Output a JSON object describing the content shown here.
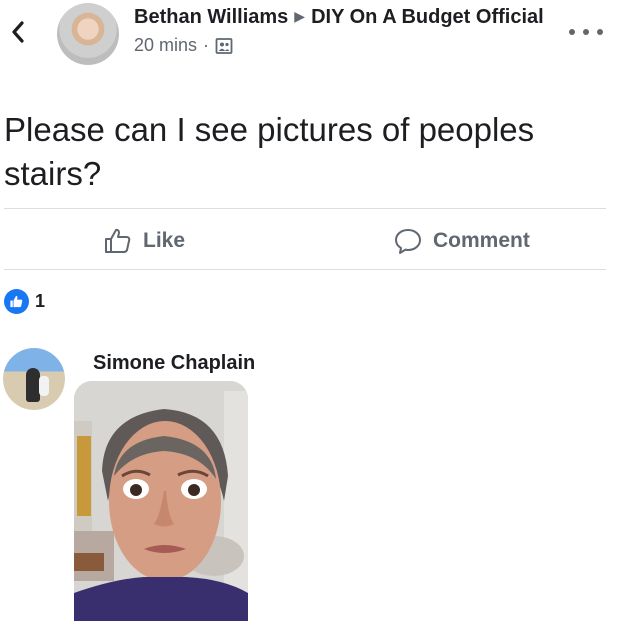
{
  "header": {
    "author": "Bethan Williams",
    "group": "DIY On A Budget Official",
    "time": "20 mins",
    "separator": "·"
  },
  "post": {
    "text": "Please can I see pictures of peoples stairs?"
  },
  "actions": {
    "like_label": "Like",
    "comment_label": "Comment"
  },
  "reactions": {
    "count": "1"
  },
  "comment": {
    "author": "Simone Chaplain"
  },
  "icons": {
    "back": "chevron-left-icon",
    "more": "more-options-icon",
    "audience": "group-audience-icon",
    "like": "thumbs-up-icon",
    "comment": "comment-bubble-icon",
    "reaction": "like-reaction-icon"
  },
  "colors": {
    "accent": "#1877f2",
    "secondary_text": "#606770",
    "divider": "#dadde1"
  }
}
